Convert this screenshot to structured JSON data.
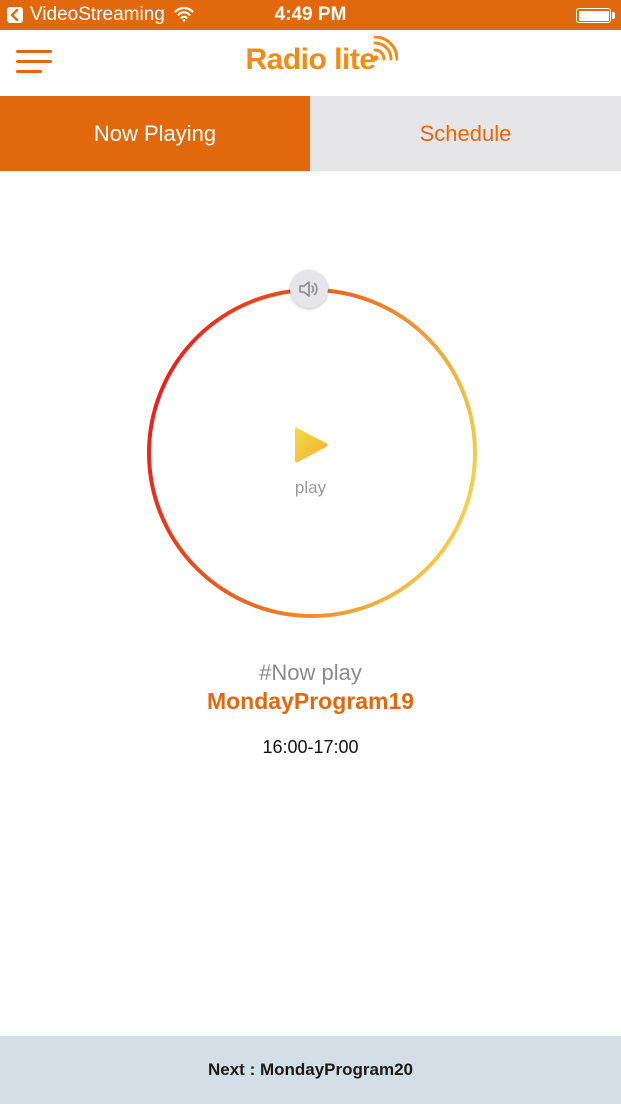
{
  "status_bar": {
    "back_app": "VideoStreaming",
    "time": "4:49 PM",
    "battery_level": 1.0,
    "wifi_icon": "wifi-icon",
    "back_icon": "chevron-left-icon"
  },
  "header": {
    "logo_text": "Radio lite",
    "menu_icon": "hamburger-menu-icon",
    "logo_icon": "broadcast-signal-icon"
  },
  "tabs": [
    {
      "label": "Now Playing",
      "active": true
    },
    {
      "label": "Schedule",
      "active": false
    }
  ],
  "player": {
    "volume_icon": "speaker-icon",
    "play_icon": "play-icon",
    "play_label": "play",
    "now_label": "#Now play",
    "program_name": "MondayProgram19",
    "program_time": "16:00-17:00"
  },
  "footer": {
    "next_label": "Next : MondayProgram20"
  },
  "colors": {
    "accent": "#e2680d",
    "logo": "#f28b12",
    "tab_inactive_bg": "#e6e6e8",
    "footer_bg": "#d3dee7",
    "ring_gradient_start": "#e8201b",
    "ring_gradient_end": "#f4d34c"
  }
}
